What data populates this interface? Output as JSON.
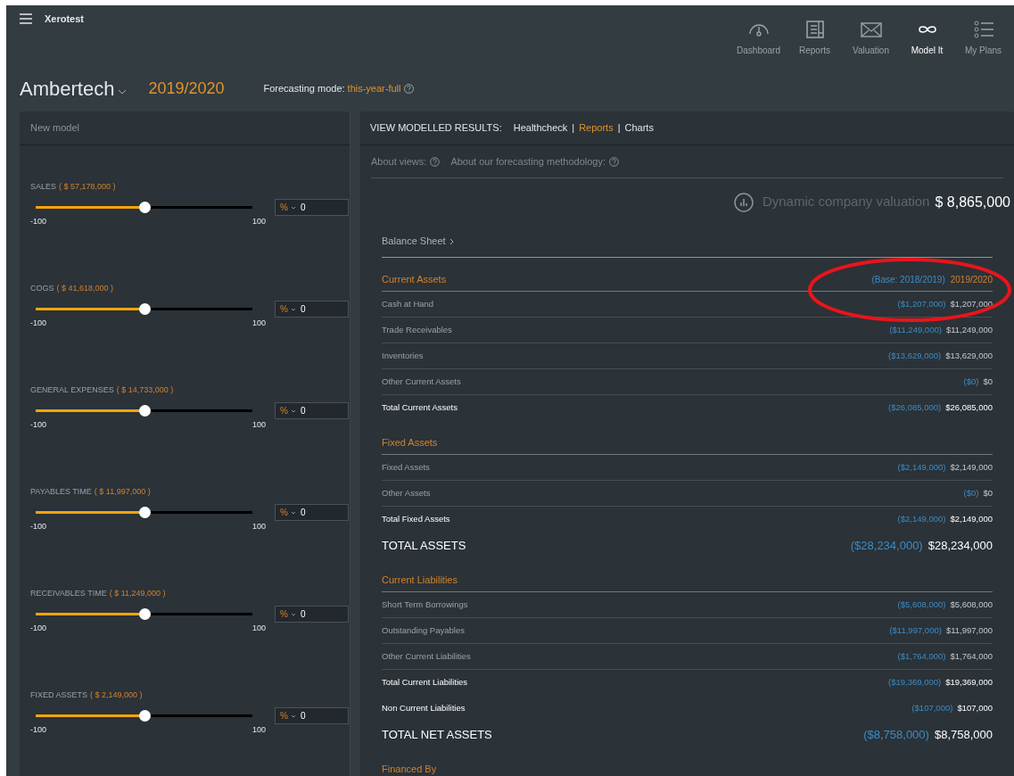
{
  "app": {
    "title": "Xerotest"
  },
  "nav": [
    {
      "label": "Dashboard",
      "selected": false
    },
    {
      "label": "Reports",
      "selected": false
    },
    {
      "label": "Valuation",
      "selected": false
    },
    {
      "label": "Model It",
      "selected": true
    },
    {
      "label": "My Plans",
      "selected": false
    }
  ],
  "company": {
    "name": "Ambertech",
    "year": "2019/2020",
    "mode_label": "Forecasting mode:",
    "mode_value": "this-year-full"
  },
  "model_panel": {
    "title": "New model",
    "sliders": [
      {
        "label": "SALES",
        "amount": "( $ 57,178,000 )",
        "level": 0.5,
        "min": "-100",
        "max": "100",
        "unit": "%",
        "value": "0"
      },
      {
        "label": "COGS",
        "amount": "( $ 41,618,000 )",
        "level": 0.5,
        "min": "-100",
        "max": "100",
        "unit": "%",
        "value": "0"
      },
      {
        "label": "GENERAL EXPENSES",
        "amount": "( $ 14,733,000 )",
        "level": 0.5,
        "min": "-100",
        "max": "100",
        "unit": "%",
        "value": "0"
      },
      {
        "label": "PAYABLES TIME",
        "amount": "( $ 11,997,000 )",
        "level": 0.5,
        "min": "-100",
        "max": "100",
        "unit": "%",
        "value": "0"
      },
      {
        "label": "RECEIVABLES TIME",
        "amount": "( $ 11,249,000 )",
        "level": 0.5,
        "min": "-100",
        "max": "100",
        "unit": "%",
        "value": "0"
      },
      {
        "label": "FIXED ASSETS",
        "amount": "( $ 2,149,000 )",
        "level": 0.5,
        "min": "-100",
        "max": "100",
        "unit": "%",
        "value": "0"
      }
    ]
  },
  "results_panel": {
    "title": "VIEW MODELLED RESULTS:",
    "view_separator": "|",
    "views": [
      {
        "label": "Healthcheck",
        "selected": false
      },
      {
        "label": "Reports",
        "selected": true
      },
      {
        "label": "Charts",
        "selected": false
      }
    ],
    "about_links": [
      "About views:",
      "About our forecasting methodology:"
    ],
    "valuation": {
      "label": "Dynamic company valuation",
      "value": "$ 8,865,000"
    },
    "sheet_title": "Balance Sheet",
    "columns": [
      "(Base: 2018/2019)",
      "2019/2020"
    ],
    "rows": [
      {
        "kind": "section",
        "label": "Current Assets"
      },
      {
        "kind": "item",
        "label": "Cash at Hand",
        "base": "($1,207,000)",
        "value": "$1,207,000"
      },
      {
        "kind": "item",
        "label": "Trade Receivables",
        "base": "($11,249,000)",
        "value": "$11,249,000"
      },
      {
        "kind": "item",
        "label": "Inventories",
        "base": "($13,629,000)",
        "value": "$13,629,000"
      },
      {
        "kind": "item",
        "label": "Other Current Assets",
        "base": "($0)",
        "value": "$0"
      },
      {
        "kind": "total",
        "label": "Total Current Assets",
        "base": "($26,085,000)",
        "value": "$26,085,000"
      },
      {
        "kind": "section",
        "label": "Fixed Assets"
      },
      {
        "kind": "item",
        "label": "Fixed Assets",
        "base": "($2,149,000)",
        "value": "$2,149,000"
      },
      {
        "kind": "item",
        "label": "Other Assets",
        "base": "($0)",
        "value": "$0"
      },
      {
        "kind": "total",
        "label": "Total Fixed Assets",
        "base": "($2,149,000)",
        "value": "$2,149,000"
      },
      {
        "kind": "grand",
        "label": "TOTAL ASSETS",
        "base": "($28,234,000)",
        "value": "$28,234,000"
      },
      {
        "kind": "section",
        "label": "Current Liabilities"
      },
      {
        "kind": "item",
        "label": "Short Term Borrowings",
        "base": "($5,608,000)",
        "value": "$5,608,000"
      },
      {
        "kind": "item",
        "label": "Outstanding Payables",
        "base": "($11,997,000)",
        "value": "$11,997,000"
      },
      {
        "kind": "item",
        "label": "Other Current Liabilities",
        "base": "($1,764,000)",
        "value": "$1,764,000"
      },
      {
        "kind": "total",
        "label": "Total Current Liabilities",
        "base": "($19,369,000)",
        "value": "$19,369,000"
      },
      {
        "kind": "total",
        "label": "Non Current Liabilities",
        "base": "($107,000)",
        "value": "$107,000"
      },
      {
        "kind": "grand",
        "label": "TOTAL NET ASSETS",
        "base": "($8,758,000)",
        "value": "$8,758,000"
      },
      {
        "kind": "section",
        "label": "Financed By"
      }
    ]
  }
}
